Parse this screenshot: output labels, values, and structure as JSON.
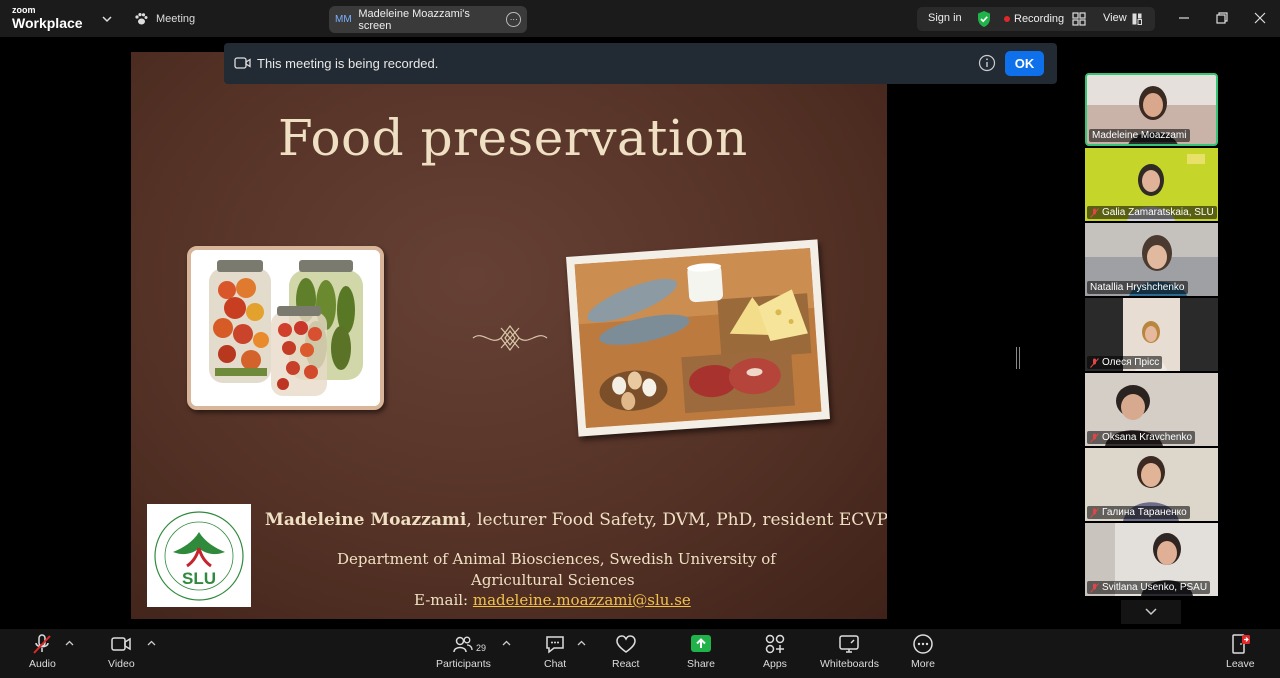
{
  "app": {
    "brand_top": "zoom",
    "brand_bottom": "Workplace",
    "meeting_label": "Meeting"
  },
  "share_pill": {
    "initials": "MM",
    "label": "Madeleine Moazzami's screen"
  },
  "topright": {
    "sign_in": "Sign in",
    "recording": "Recording",
    "view": "View"
  },
  "banner": {
    "text": "This meeting is being recorded.",
    "ok": "OK"
  },
  "slide": {
    "title": "Food preservation",
    "presenter_name": "Madeleine Moazzami",
    "presenter_role": ", lecturer Food Safety, DVM, PhD, resident ECVPH",
    "dept_line1": "Department of Animal Biosciences, Swedish University of",
    "dept_line2": "Agricultural Sciences",
    "email_label": "E-mail: ",
    "email": "madeleine.moazzami@slu.se",
    "logo_text": "SLU",
    "logo_ring_text": "SWEDISH UNIVERSITY OF AGRICULTURAL SCIENCES"
  },
  "participants": [
    {
      "name": "Madeleine Moazzami",
      "muted": false,
      "bg": "#b89a8a"
    },
    {
      "name": "Galia Zamaratskaia, SLU",
      "muted": true,
      "bg": "#c9d62a"
    },
    {
      "name": "Natallia Hryshchenko",
      "muted": false,
      "bg": "#8e8f93"
    },
    {
      "name": "Олеся Прісс",
      "muted": true,
      "bg": "#2a2a2a"
    },
    {
      "name": "Oksana Kravchenko",
      "muted": true,
      "bg": "#cfc7c0"
    },
    {
      "name": "Галина Тараненко",
      "muted": true,
      "bg": "#d8d2c6"
    },
    {
      "name": "Svitlana Usenko, PSAU",
      "muted": true,
      "bg": "#e0dcd8"
    }
  ],
  "toolbar": {
    "audio": "Audio",
    "video": "Video",
    "participants": "Participants",
    "participant_count": "29",
    "chat": "Chat",
    "react": "React",
    "share": "Share",
    "apps": "Apps",
    "whiteboards": "Whiteboards",
    "more": "More",
    "leave": "Leave"
  },
  "colors": {
    "accent": "#0e71eb",
    "share_green": "#1fb34a",
    "record_red": "#e02828",
    "active_speaker": "#34c576",
    "leave_red": "#e02828"
  }
}
